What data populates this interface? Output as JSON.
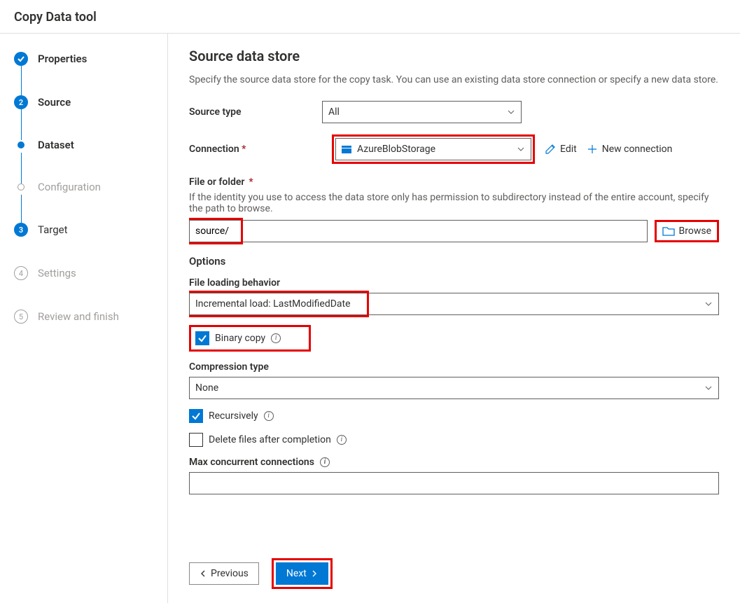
{
  "header": {
    "title": "Copy Data tool"
  },
  "sidebar": {
    "steps": [
      {
        "label": "Properties",
        "state": "done"
      },
      {
        "label": "Source",
        "state": "active"
      },
      {
        "label": "Dataset",
        "state": "sub-active"
      },
      {
        "label": "Configuration",
        "state": "sub-pending"
      },
      {
        "label": "Target",
        "state": "numbered",
        "num": "3"
      },
      {
        "label": "Settings",
        "state": "pending",
        "num": "4"
      },
      {
        "label": "Review and finish",
        "state": "pending",
        "num": "5"
      }
    ]
  },
  "main": {
    "title": "Source data store",
    "description": "Specify the source data store for the copy task. You can use an existing data store connection or specify a new data store.",
    "sourceType": {
      "label": "Source type",
      "value": "All"
    },
    "connection": {
      "label": "Connection",
      "value": "AzureBlobStorage",
      "editLabel": "Edit",
      "newLabel": "New connection"
    },
    "fileOrFolder": {
      "label": "File or folder",
      "helper": "If the identity you use to access the data store only has permission to subdirectory instead of the entire account, specify the path to browse.",
      "value": "source/",
      "browseLabel": "Browse"
    },
    "optionsTitle": "Options",
    "fileLoading": {
      "label": "File loading behavior",
      "value": "Incremental load: LastModifiedDate"
    },
    "binaryCopy": {
      "label": "Binary copy",
      "checked": true
    },
    "compression": {
      "label": "Compression type",
      "value": "None"
    },
    "recursively": {
      "label": "Recursively",
      "checked": true
    },
    "deleteAfter": {
      "label": "Delete files after completion",
      "checked": false
    },
    "maxConn": {
      "label": "Max concurrent connections",
      "value": ""
    }
  },
  "footer": {
    "prev": "Previous",
    "next": "Next"
  }
}
